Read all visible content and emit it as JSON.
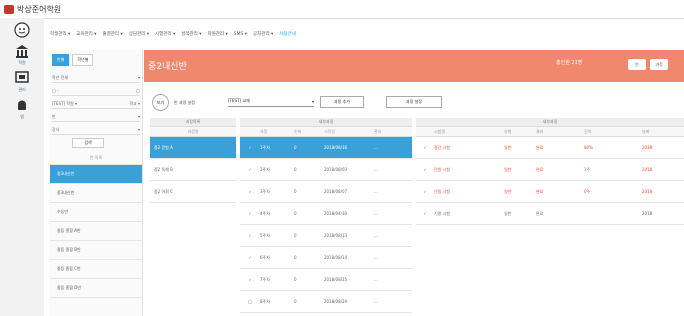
{
  "app": {
    "title": "박상준어학원"
  },
  "leftnav": [
    {
      "icon": "avatar-icon",
      "label": ""
    },
    {
      "icon": "bank-icon",
      "label": "학원"
    },
    {
      "icon": "monitor-icon",
      "label": "관리"
    },
    {
      "icon": "android-icon",
      "label": "앱"
    }
  ],
  "topmenu": [
    "학생관리 ▾",
    "교육관리 ▾",
    "출결관리 ▾",
    "상담관리 ▾",
    "시험관리 ▾",
    "성적관리 ▾",
    "학원관리 ▾",
    "SMS ▾",
    "공지관리 ▾",
    "사용안내"
  ],
  "sidepanel": {
    "tabs": [
      "반별",
      "학년별"
    ],
    "filters": [
      {
        "label": "학년 전체",
        "value": "▾"
      },
      {
        "label": "□ -",
        "value": "□"
      },
      {
        "label": "[TEST] 학원 ▾",
        "value": "학교 ▾"
      },
      {
        "label": "반",
        "value": "▾"
      },
      {
        "label": "강사",
        "value": "▾"
      }
    ],
    "search_btn": "검색",
    "list_header": "반 목록",
    "items": [
      "중3내신반",
      "중3내신반",
      "수능반",
      "중등 종합 A반",
      "중등 종합 B반",
      "중등 종합 C반",
      "중등 종합 D반"
    ]
  },
  "header": {
    "title": "중2내신반",
    "hint": "총인원 21명",
    "btn1": "반",
    "btn2": "과정"
  },
  "toolbar": {
    "circle_label": "보기",
    "label": "반 과정 설정",
    "select": "[TEST] 교재",
    "btn1": "과정 추가",
    "btn2": "과정 설정"
  },
  "tables": {
    "left_header": "과정목록",
    "left_sub": "과정명",
    "left_rows": [
      "중2 문법 A",
      "중2 독해 B",
      "중2 어휘 C"
    ],
    "mid_header": "세부과정",
    "mid_cols": [
      "",
      "과정",
      "순위",
      "시작일",
      "관리"
    ],
    "mid_rows": [
      [
        "✓",
        "1주차",
        "0",
        "2018/08/16",
        "..."
      ],
      [
        "✓",
        "2주차",
        "0",
        "2018/08/03",
        "..."
      ],
      [
        "✓",
        "3주차",
        "0",
        "2018/08/07",
        "..."
      ],
      [
        "✓",
        "4주차",
        "0",
        "2018/04/30",
        "..."
      ],
      [
        "✓",
        "5주차",
        "0",
        "2018/08/13",
        "..."
      ],
      [
        "✓",
        "6주차",
        "0",
        "2018/08/14",
        "..."
      ],
      [
        "✓",
        "7주차",
        "0",
        "2018/08/25",
        "..."
      ],
      [
        "□",
        "8주차",
        "0",
        "2018/08/29",
        "..."
      ]
    ],
    "right_header": "세부과정",
    "right_cols": [
      "",
      "시험명",
      "유형",
      "결과",
      "진척",
      "날짜"
    ],
    "right_rows": [
      [
        "✓",
        "중간 시험",
        "일반",
        "완료",
        "80%",
        "2018"
      ],
      [
        "✓",
        "단원 시험",
        "일반",
        "완료",
        "1주",
        "2018"
      ],
      [
        "✓",
        "단원 시험",
        "일반",
        "완료",
        "0주",
        "2018"
      ],
      [
        "✓",
        "기말 시험",
        "일반",
        "완료",
        "",
        "2018"
      ]
    ]
  }
}
